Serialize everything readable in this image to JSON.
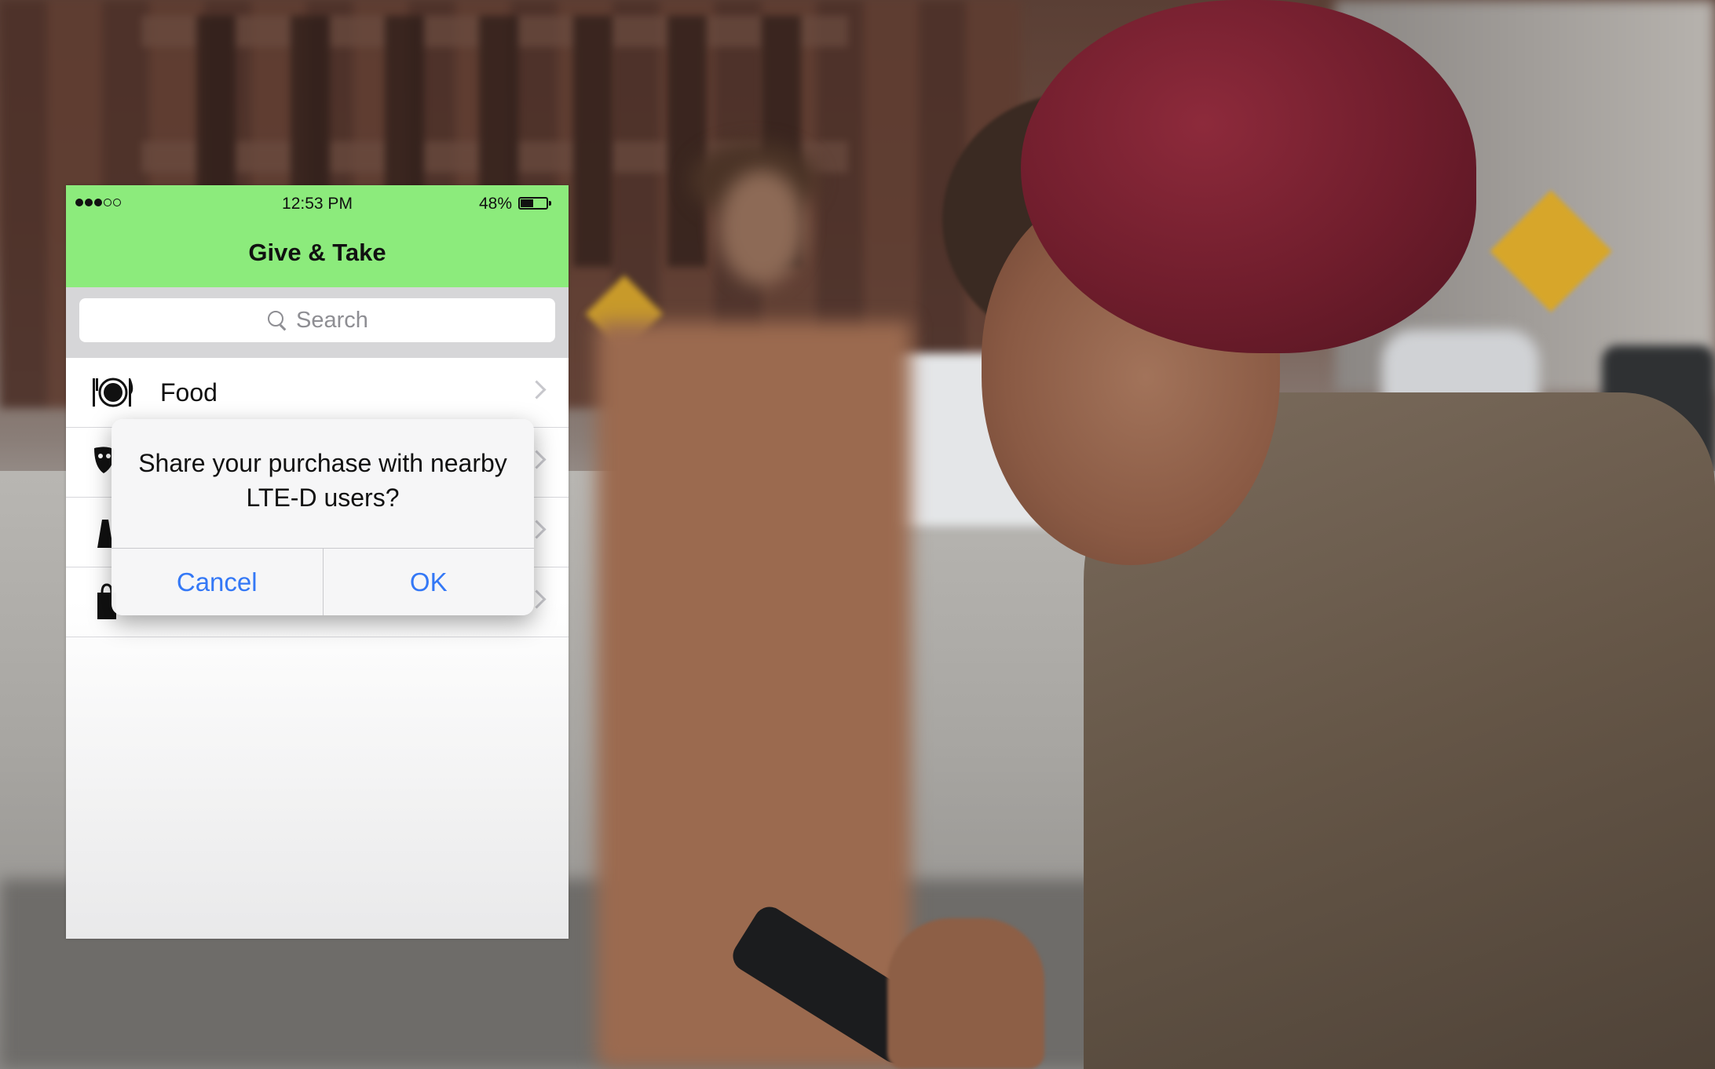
{
  "status_bar": {
    "signal_bars": [
      true,
      true,
      true,
      false,
      false
    ],
    "time": "12:53 PM",
    "battery_percent": "48%",
    "battery_level": 0.48
  },
  "nav": {
    "title": "Give & Take",
    "color": "#8ceb7c"
  },
  "search": {
    "placeholder": "Search"
  },
  "list": {
    "items": [
      {
        "label": "Food",
        "icon": "plate-fork-knife-icon"
      },
      {
        "label": "",
        "icon": "theater-mask-icon"
      },
      {
        "label": "",
        "icon": "clothing-icon"
      },
      {
        "label": "",
        "icon": "shopping-bag-icon"
      }
    ]
  },
  "alert": {
    "message": "Share your purchase with nearby LTE-D users?",
    "cancel_label": "Cancel",
    "ok_label": "OK",
    "button_color": "#3478f6"
  }
}
